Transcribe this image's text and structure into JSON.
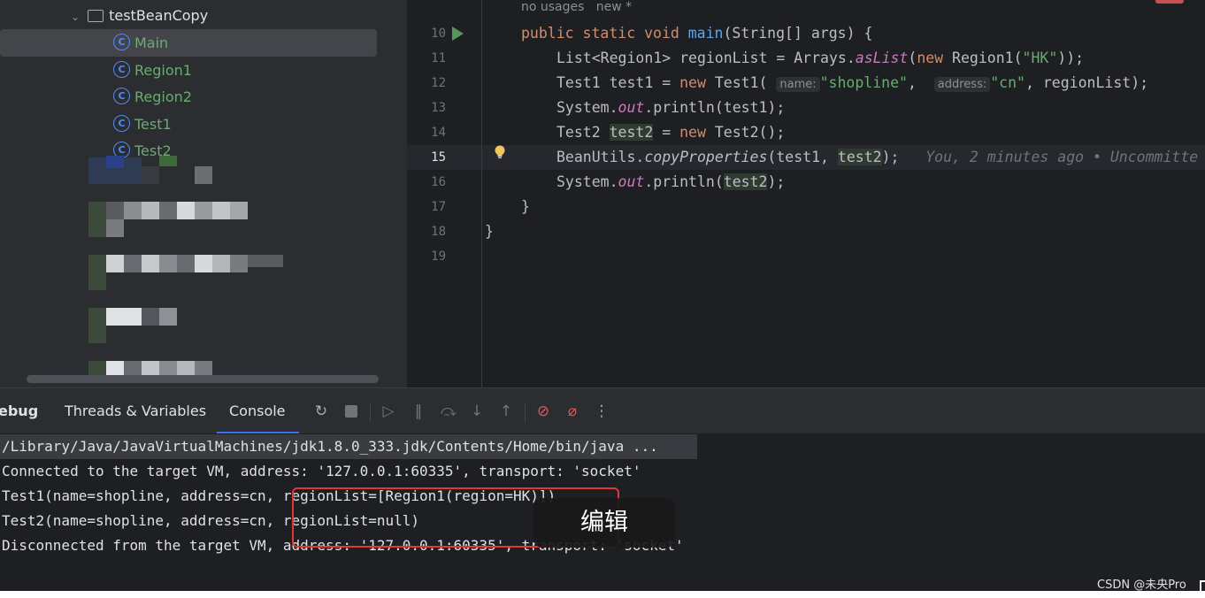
{
  "project_tree": {
    "folder": "testBeanCopy",
    "classes": [
      "Main",
      "Region1",
      "Region2",
      "Test1",
      "Test2"
    ],
    "selected": "Main",
    "class_icon_glyph": "C"
  },
  "editor": {
    "usage_hint": "no usages",
    "usage_new": "new *",
    "lines": [
      {
        "num": "10"
      },
      {
        "num": "11"
      },
      {
        "num": "12"
      },
      {
        "num": "13"
      },
      {
        "num": "14"
      },
      {
        "num": "15"
      },
      {
        "num": "16"
      },
      {
        "num": "17"
      },
      {
        "num": "18"
      },
      {
        "num": "19"
      }
    ],
    "param_hint_name": "name:",
    "param_hint_address": "address:",
    "blame": "You, 2 minutes ago • Uncommitte"
  },
  "debug": {
    "tab_debug": "ebug",
    "tab_threads": "Threads & Variables",
    "tab_console": "Console",
    "active_tab": "Console"
  },
  "console": {
    "lines": [
      "/Library/Java/JavaVirtualMachines/jdk1.8.0_333.jdk/Contents/Home/bin/java ...",
      "Connected to the target VM, address: '127.0.0.1:60335', transport: 'socket'",
      "Test1(name=shopline, address=cn, regionList=[Region1(region=HK)])",
      "Test2(name=shopline, address=cn, regionList=null)",
      "Disconnected from the target VM, address: '127.0.0.1:60335', transport: 'socket'"
    ]
  },
  "overlay": {
    "edit_label": "编辑",
    "watermark": "CSDN @未央Pro"
  },
  "colors": {
    "keyword": "#cf8e6d",
    "function": "#56a8f5",
    "string": "#6aab73",
    "static_field": "#c77dbb",
    "annotation_box": "#e03a2f",
    "active_tab_underline": "#3574f0"
  }
}
